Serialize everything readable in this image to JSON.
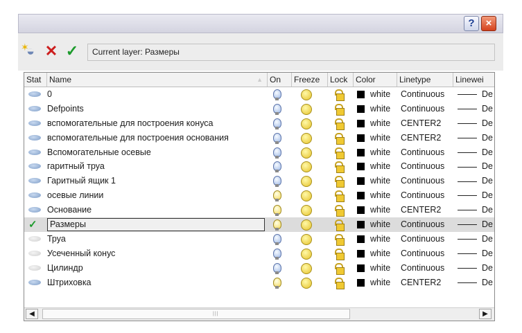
{
  "titlebar": {
    "help_label": "?",
    "close_label": "×"
  },
  "toolbar": {
    "current_layer_text": "Current layer: Размеры"
  },
  "columns": [
    "Stat",
    "Name",
    "On",
    "Freeze",
    "Lock",
    "Color",
    "Linetype",
    "Linewei"
  ],
  "layers": [
    {
      "name": "0",
      "status": "layer",
      "on": false,
      "color": "white",
      "linetype": "Continuous",
      "lineweight": "De"
    },
    {
      "name": "Defpoints",
      "status": "layer",
      "on": false,
      "color": "white",
      "linetype": "Continuous",
      "lineweight": "De"
    },
    {
      "name": "вспомогательные для построения конуса",
      "status": "layer",
      "on": false,
      "color": "white",
      "linetype": "CENTER2",
      "lineweight": "De"
    },
    {
      "name": "вспомогательные для построения основания",
      "status": "layer",
      "on": false,
      "color": "white",
      "linetype": "CENTER2",
      "lineweight": "De"
    },
    {
      "name": "Вспомогательные осевые",
      "status": "layer",
      "on": false,
      "color": "white",
      "linetype": "Continuous",
      "lineweight": "De"
    },
    {
      "name": "гаритный труа",
      "status": "layer",
      "on": false,
      "color": "white",
      "linetype": "Continuous",
      "lineweight": "De"
    },
    {
      "name": "Гаритный ящик 1",
      "status": "layer",
      "on": false,
      "color": "white",
      "linetype": "Continuous",
      "lineweight": "De"
    },
    {
      "name": "осевые линии",
      "status": "layer",
      "on": true,
      "color": "white",
      "linetype": "Continuous",
      "lineweight": "De"
    },
    {
      "name": "Основание",
      "status": "layer",
      "on": true,
      "color": "white",
      "linetype": "CENTER2",
      "lineweight": "De"
    },
    {
      "name": "Размеры",
      "status": "current",
      "on": true,
      "color": "white",
      "linetype": "Continuous",
      "lineweight": "De"
    },
    {
      "name": "Труа",
      "status": "dim",
      "on": false,
      "color": "white",
      "linetype": "Continuous",
      "lineweight": "De"
    },
    {
      "name": "Усеченный конус",
      "status": "dim",
      "on": false,
      "color": "white",
      "linetype": "Continuous",
      "lineweight": "De"
    },
    {
      "name": "Цилиндр",
      "status": "dim",
      "on": false,
      "color": "white",
      "linetype": "Continuous",
      "lineweight": "De"
    },
    {
      "name": "Штриховка",
      "status": "layer",
      "on": true,
      "color": "white",
      "linetype": "CENTER2",
      "lineweight": "De"
    }
  ]
}
